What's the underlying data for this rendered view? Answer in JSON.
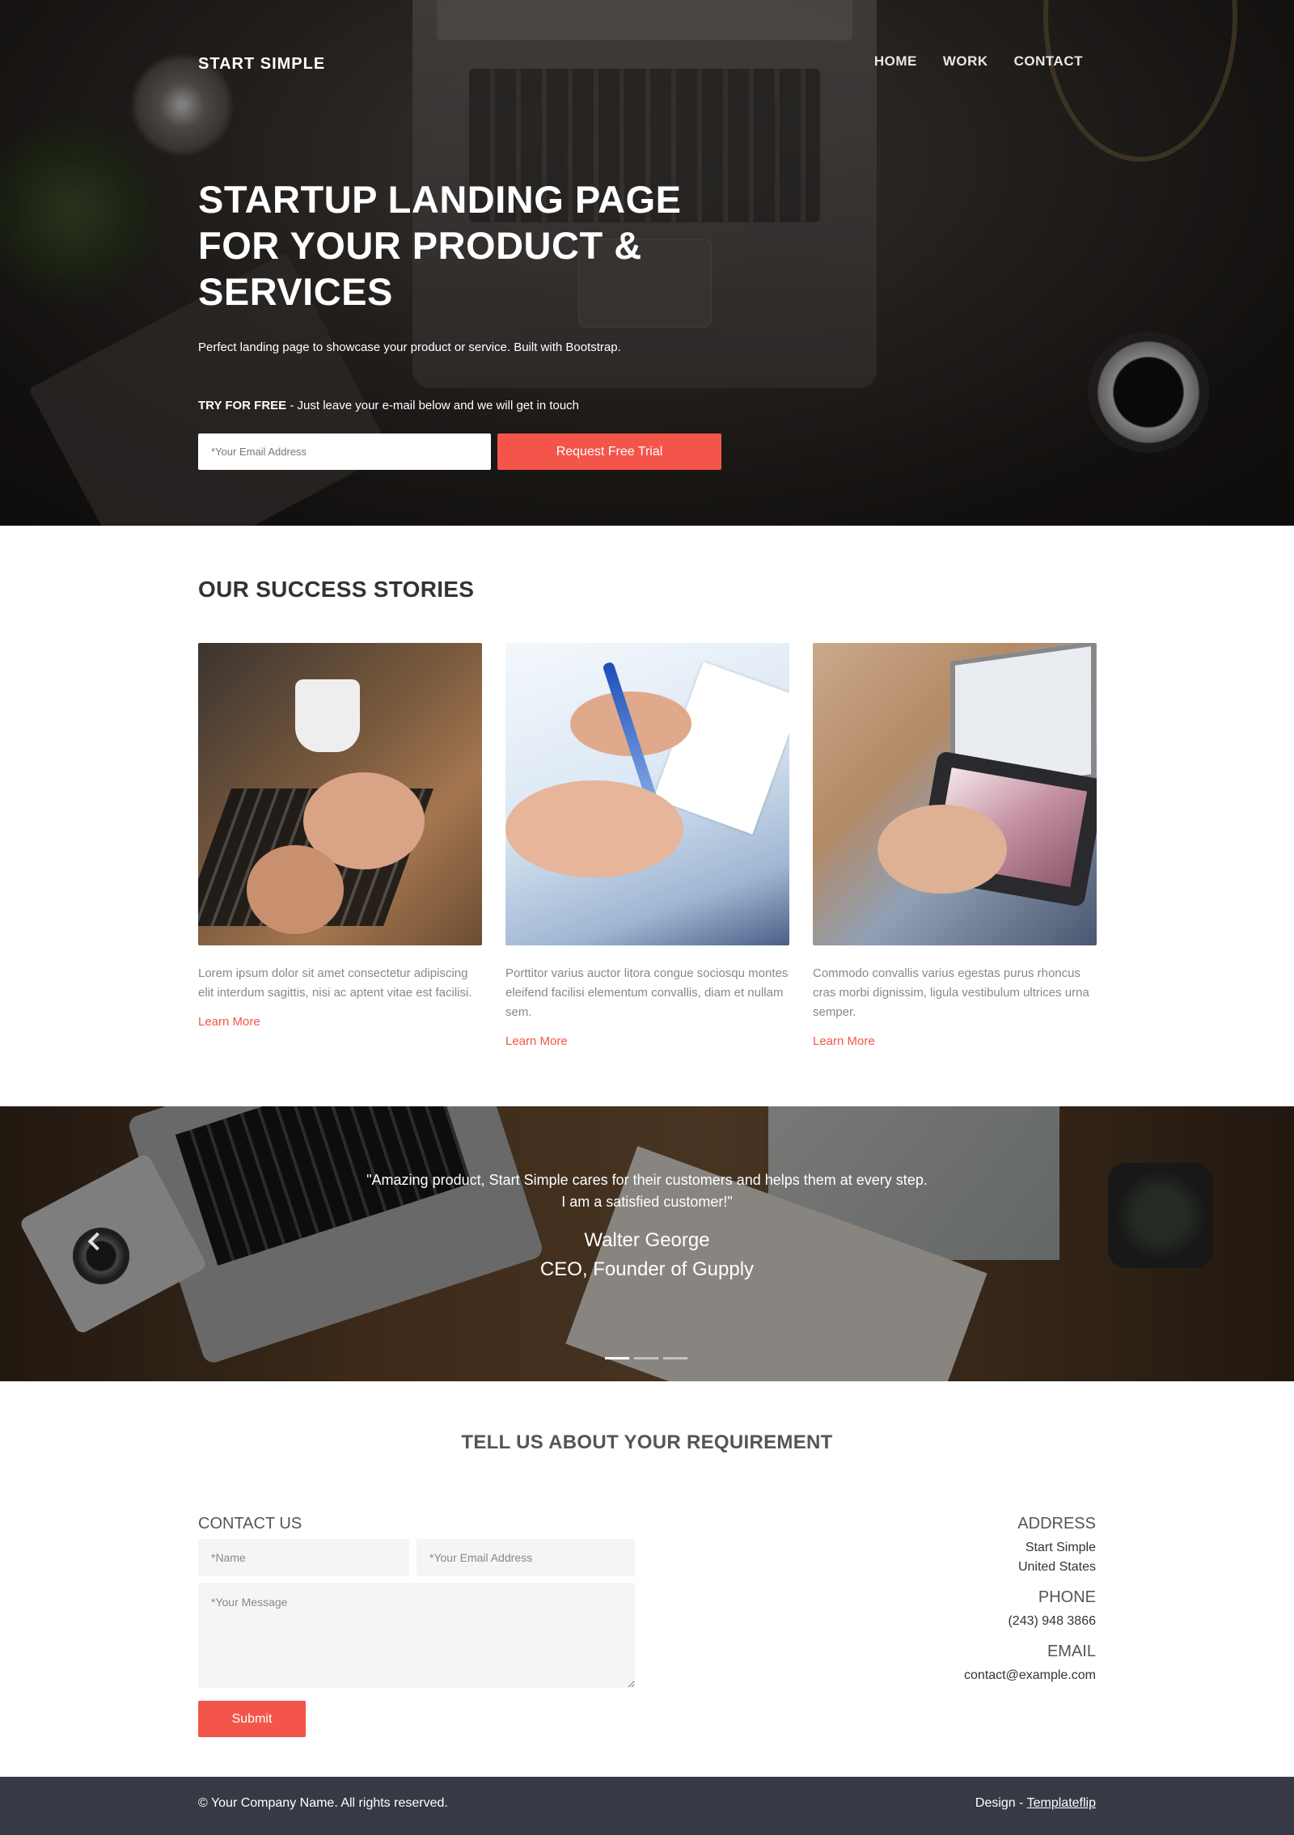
{
  "header": {
    "brand": "START SIMPLE",
    "nav": [
      "HOME",
      "WORK",
      "CONTACT"
    ]
  },
  "hero": {
    "title": "STARTUP LANDING PAGE FOR YOUR PRODUCT & SERVICES",
    "subtitle": "Perfect landing page to showcase your product or service. Built with Bootstrap.",
    "cta_strong": "TRY FOR FREE",
    "cta_text": " - Just leave your e-mail below and we will get in touch",
    "email_placeholder": "*Your Email Address",
    "button_label": "Request Free Trial"
  },
  "stories": {
    "title": "OUR SUCCESS STORIES",
    "items": [
      {
        "image": "laptop-typing-photo",
        "text": "Lorem ipsum dolor sit amet consectetur adipiscing elit interdum sagittis, nisi ac aptent vitae est facilisi.",
        "link": "Learn More"
      },
      {
        "image": "contract-signing-photo",
        "text": "Porttitor varius auctor litora congue sociosqu montes eleifend facilisi elementum convallis, diam et nullam sem.",
        "link": "Learn More"
      },
      {
        "image": "tablet-browsing-photo",
        "text": "Commodo convallis varius egestas purus rhoncus cras morbi dignissim, ligula vestibulum ultrices urna semper.",
        "link": "Learn More"
      }
    ]
  },
  "testimonial": {
    "quote_line1": "\"Amazing product, Start Simple cares for their customers and helps them at every step.",
    "quote_line2": "I am a satisfied customer!\"",
    "name": "Walter George",
    "role": "CEO, Founder of Gupply",
    "slides": 3,
    "active_slide": 1
  },
  "contact": {
    "section_title": "TELL US ABOUT YOUR REQUIREMENT",
    "form_title": "CONTACT US",
    "name_placeholder": "*Name",
    "email_placeholder": "*Your Email Address",
    "message_placeholder": "*Your Message",
    "submit_label": "Submit",
    "address_title": "ADDRESS",
    "address_line1": "Start Simple",
    "address_line2": "United States",
    "phone_title": "PHONE",
    "phone": "(243) 948 3866",
    "email_title": "EMAIL",
    "email": "contact@example.com"
  },
  "footer": {
    "copyright": "© Your Company Name. All rights reserved.",
    "design_prefix": "Design - ",
    "design_link": "Templateflip"
  },
  "colors": {
    "accent": "#f4554a",
    "footer_bg": "#363a45",
    "input_bg": "#f4f5f7"
  }
}
